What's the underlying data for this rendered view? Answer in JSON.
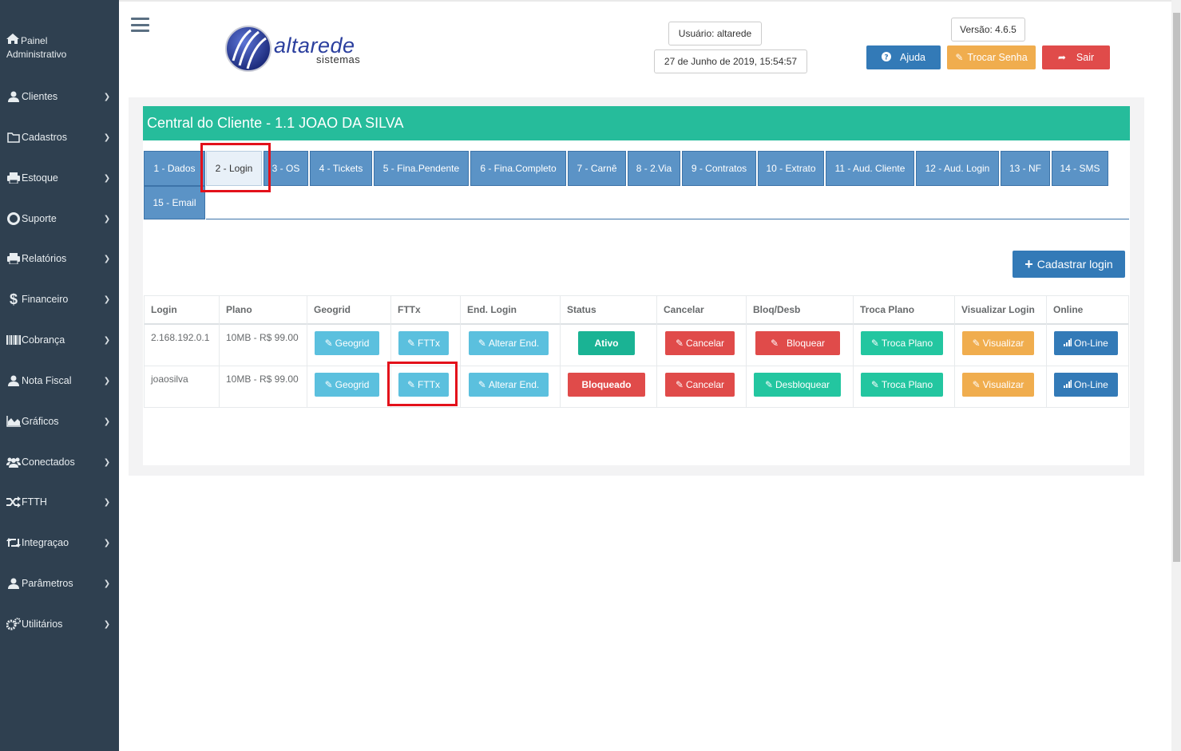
{
  "sidebar": {
    "top_label_1": "Painel",
    "top_label_2": "Administrativo",
    "items": [
      {
        "label": "Clientes",
        "icon": "user-icon"
      },
      {
        "label": "Cadastros",
        "icon": "folder-icon"
      },
      {
        "label": "Estoque",
        "icon": "printer-icon"
      },
      {
        "label": "Suporte",
        "icon": "lifebuoy-icon"
      },
      {
        "label": "Relatórios",
        "icon": "printer-icon"
      },
      {
        "label": "Financeiro",
        "icon": "dollar-icon"
      },
      {
        "label": "Cobrança",
        "icon": "barcode-icon"
      },
      {
        "label": "Nota Fiscal",
        "icon": "user-icon"
      },
      {
        "label": "Gráficos",
        "icon": "area-chart-icon"
      },
      {
        "label": "Conectados",
        "icon": "users-icon"
      },
      {
        "label": "FTTH",
        "icon": "shuffle-icon"
      },
      {
        "label": "Integraçao",
        "icon": "retweet-icon"
      },
      {
        "label": "Parâmetros",
        "icon": "user-icon"
      },
      {
        "label": "Utilitários",
        "icon": "gears-icon"
      }
    ]
  },
  "header": {
    "logo_text": "altarede",
    "logo_sub": "sistemas",
    "user": "Usuário: altarede",
    "datetime": "27 de Junho de 2019, 15:54:57",
    "version": "Versão: 4.6.5",
    "help": "Ajuda",
    "change_password": "Trocar Senha",
    "exit": "Sair"
  },
  "colors": {
    "sidebar_bg": "#2f4050",
    "title_bg": "#26bc9b",
    "tab_bg": "#5b93c6",
    "highlight": "#e3111b"
  },
  "page": {
    "title": "Central do Cliente - 1.1 JOAO DA SILVA",
    "tabs": [
      "1 - Dados",
      "2 - Login",
      "3 - OS",
      "4 - Tickets",
      "5 - Fina.Pendente",
      "6 - Fina.Completo",
      "7 - Carnê",
      "8 - 2.Via",
      "9 - Contratos",
      "10 - Extrato",
      "11 - Aud. Cliente",
      "12 - Aud. Login",
      "13 - NF",
      "14 - SMS",
      "15 - Email"
    ],
    "active_tab": "2 - Login",
    "add_login": "Cadastrar login"
  },
  "table": {
    "headers": [
      "Login",
      "Plano",
      "Geogrid",
      "FTTx",
      "End. Login",
      "Status",
      "Cancelar",
      "Bloq/Desb",
      "Troca Plano",
      "Visualizar Login",
      "Online"
    ],
    "rows": [
      {
        "login": "2.168.192.0.1",
        "plano": "10MB - R$ 99.00",
        "geogrid": "Geogrid",
        "fttx": "FTTx",
        "end": "Alterar End.",
        "status": "Ativo",
        "cancelar": "Cancelar",
        "bloq": "Bloquear",
        "troca": "Troca Plano",
        "visualizar": "Visualizar",
        "online": "On-Line"
      },
      {
        "login": "joaosilva",
        "plano": "10MB - R$ 99.00",
        "geogrid": "Geogrid",
        "fttx": "FTTx",
        "end": "Alterar End.",
        "status": "Bloqueado",
        "cancelar": "Cancelar",
        "bloq": "Desbloquear",
        "troca": "Troca Plano",
        "visualizar": "Visualizar",
        "online": "On-Line"
      }
    ]
  }
}
